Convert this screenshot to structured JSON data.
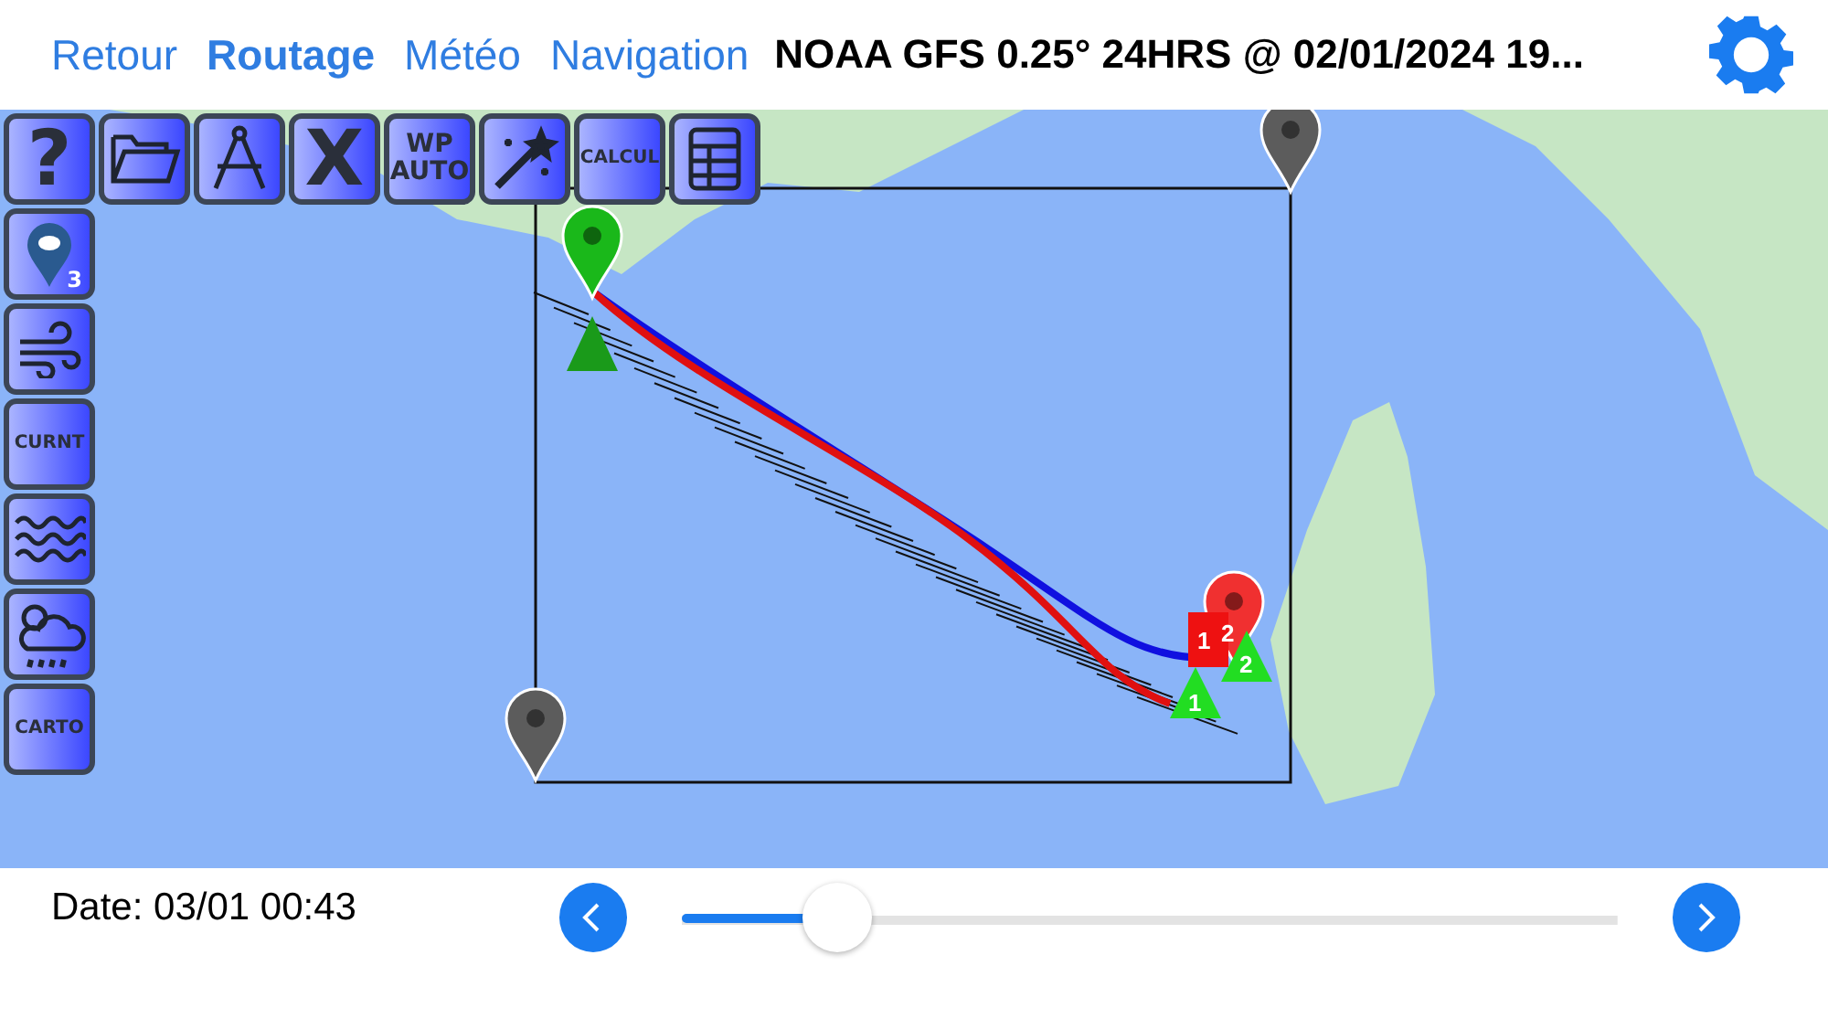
{
  "nav": [
    {
      "label": "Retour",
      "selected": false
    },
    {
      "label": "Routage",
      "selected": true
    },
    {
      "label": "Météo",
      "selected": false
    },
    {
      "label": "Navigation",
      "selected": false
    }
  ],
  "title": "NOAA GFS 0.25° 24HRS @ 02/01/2024 19...",
  "tools": [
    {
      "kind": "text",
      "label": "?"
    },
    {
      "kind": "icon"
    },
    {
      "kind": "icon"
    },
    {
      "kind": "text",
      "label": "X"
    },
    {
      "kind": "text",
      "label": "WP AUTO"
    },
    {
      "kind": "icon"
    },
    {
      "kind": "smalltext",
      "label": "CALCUL"
    },
    {
      "kind": "icon"
    }
  ],
  "side_tools": [
    {
      "kind": "badge",
      "label": "3"
    },
    {
      "kind": "icon"
    },
    {
      "kind": "smalltext",
      "label": "CURNT"
    },
    {
      "kind": "icon"
    },
    {
      "kind": "icon"
    },
    {
      "kind": "smalltext",
      "label": "CARTO"
    }
  ],
  "map_badges": [
    "1",
    "2",
    "1",
    "2"
  ],
  "date": "Date: 03/01 00:43",
  "slider": {
    "level": 0.14
  }
}
